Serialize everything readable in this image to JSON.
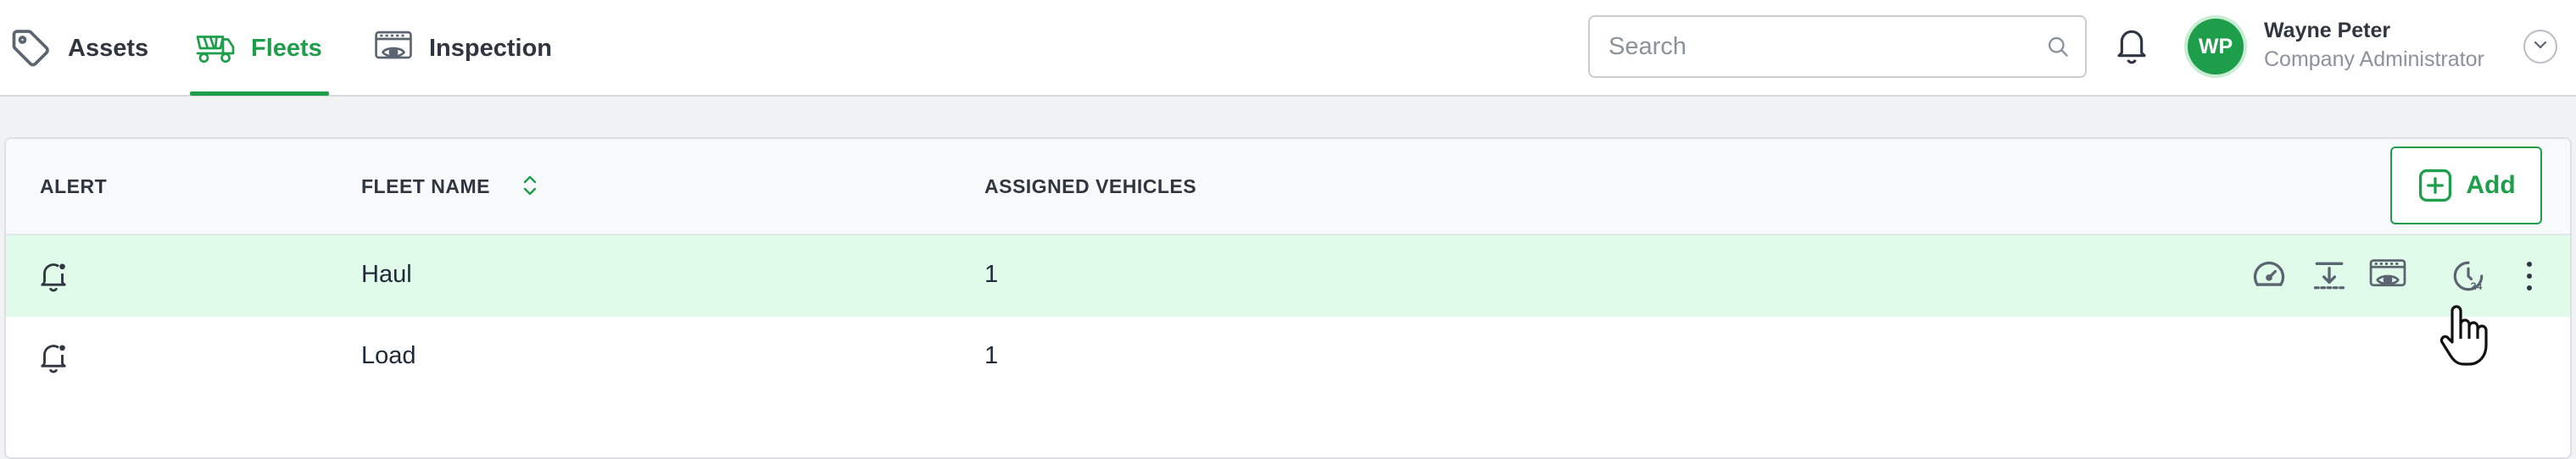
{
  "nav": {
    "tabs": [
      {
        "label": "Assets",
        "icon": "tag-icon",
        "active": false
      },
      {
        "label": "Fleets",
        "icon": "fleet-truck-icon",
        "active": true
      },
      {
        "label": "Inspection",
        "icon": "inspection-icon",
        "active": false
      }
    ]
  },
  "search": {
    "placeholder": "Search",
    "value": ""
  },
  "user": {
    "initials": "WP",
    "name": "Wayne Peter",
    "role": "Company Administrator"
  },
  "table": {
    "headers": {
      "alert": "ALERT",
      "fleet_name": "FLEET NAME",
      "assigned_vehicles": "ASSIGNED VEHICLES"
    },
    "add_label": "Add",
    "rows": [
      {
        "fleet_name": "Haul",
        "assigned_vehicles": "1",
        "highlighted": true
      },
      {
        "fleet_name": "Load",
        "assigned_vehicles": "1",
        "highlighted": false
      }
    ],
    "row_actions": [
      "speedometer-icon",
      "import-icon",
      "inspection-icon",
      "timer-24-icon",
      "more-vertical-icon"
    ]
  },
  "colors": {
    "accent": "#1e9e4a",
    "row_highlight": "#e1fbea",
    "background": "#f1f2f4",
    "text": "#1f2937"
  }
}
